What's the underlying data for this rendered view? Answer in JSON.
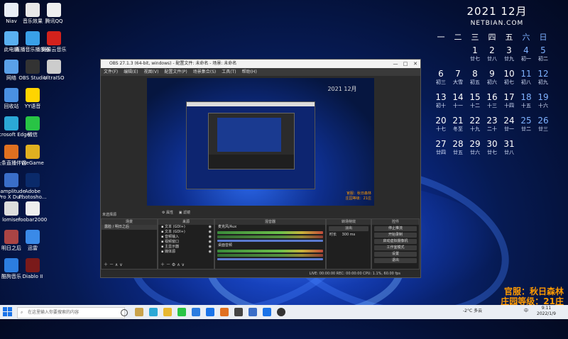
{
  "desktop": {
    "icons": [
      {
        "label": "Niav",
        "color": "#e9eef5"
      },
      {
        "label": "回收站",
        "color": "#4a90e2"
      },
      {
        "label": "网络",
        "color": "#5aa0e8"
      },
      {
        "label": "此电脑",
        "color": "#5ab0f0"
      },
      {
        "label": "音乐效果",
        "color": "#e8e8e8"
      },
      {
        "label": "Microsoft Edge",
        "color": "#2ba8d6"
      },
      {
        "label": "头条直播伴侣",
        "color": "#e07020"
      },
      {
        "label": "Samplitude Pro X Du...",
        "color": "#3a6ec8"
      },
      {
        "label": "lomiser",
        "color": "#ddd"
      },
      {
        "label": "明日之后",
        "color": "#aa4444"
      },
      {
        "label": "酷狗音乐",
        "color": "#2c7de0"
      },
      {
        "label": "腾讯QQ",
        "color": "#eee"
      },
      {
        "label": "直播音乐播放器",
        "color": "#39a0e8"
      },
      {
        "label": "OBS Studio",
        "color": "#333"
      },
      {
        "label": "YY语音",
        "color": "#ffd400"
      },
      {
        "label": "微信",
        "color": "#28c445"
      },
      {
        "label": "WeGame",
        "color": "#e0b020"
      },
      {
        "label": "Adobe Photosho...",
        "color": "#0a2a6a"
      },
      {
        "label": "foobar2000",
        "color": "#eee"
      },
      {
        "label": "迅雷",
        "color": "#3a8ae8"
      },
      {
        "label": "Diablo II",
        "color": "#7a1a1a"
      },
      {
        "label": "网易云音乐",
        "color": "#d4221c"
      },
      {
        "label": "UltraISO",
        "color": "#cccccc"
      }
    ]
  },
  "calendar": {
    "title": "2021 12月",
    "site": "NETBIAN.COM",
    "weekdays": [
      "一",
      "二",
      "三",
      "四",
      "五",
      "六",
      "日"
    ],
    "weeks": [
      [
        {
          "d": "",
          "l": ""
        },
        {
          "d": "",
          "l": ""
        },
        {
          "d": "1",
          "l": "廿七"
        },
        {
          "d": "2",
          "l": "廿八"
        },
        {
          "d": "3",
          "l": "廿九"
        },
        {
          "d": "4",
          "l": "初一"
        },
        {
          "d": "5",
          "l": "初二"
        }
      ],
      [
        {
          "d": "6",
          "l": "初三"
        },
        {
          "d": "7",
          "l": "大雪"
        },
        {
          "d": "8",
          "l": "初五"
        },
        {
          "d": "9",
          "l": "初六"
        },
        {
          "d": "10",
          "l": "初七"
        },
        {
          "d": "11",
          "l": "初八"
        },
        {
          "d": "12",
          "l": "初九"
        }
      ],
      [
        {
          "d": "13",
          "l": "初十"
        },
        {
          "d": "14",
          "l": "十一"
        },
        {
          "d": "15",
          "l": "十二"
        },
        {
          "d": "16",
          "l": "十三"
        },
        {
          "d": "17",
          "l": "十四"
        },
        {
          "d": "18",
          "l": "十五"
        },
        {
          "d": "19",
          "l": "十六"
        }
      ],
      [
        {
          "d": "20",
          "l": "十七"
        },
        {
          "d": "21",
          "l": "冬至"
        },
        {
          "d": "22",
          "l": "十九"
        },
        {
          "d": "23",
          "l": "二十"
        },
        {
          "d": "24",
          "l": "廿一"
        },
        {
          "d": "25",
          "l": "廿二"
        },
        {
          "d": "26",
          "l": "廿三"
        }
      ],
      [
        {
          "d": "27",
          "l": "廿四"
        },
        {
          "d": "28",
          "l": "廿五"
        },
        {
          "d": "29",
          "l": "廿六"
        },
        {
          "d": "30",
          "l": "廿七"
        },
        {
          "d": "31",
          "l": "廿八"
        },
        {
          "d": "",
          "l": ""
        },
        {
          "d": "",
          "l": ""
        }
      ]
    ]
  },
  "obs": {
    "title": "OBS 27.1.3 (64-bit, windows) - 配置文件: 未命名 - 场景: 未命名",
    "menu": [
      "文件(F)",
      "编辑(E)",
      "视图(V)",
      "配置文件(P)",
      "场景集合(S)",
      "工具(T)",
      "帮助(H)"
    ],
    "no_source": "未选择源",
    "props_label": "属性",
    "filters_label": "滤镜",
    "docks": {
      "scenes": {
        "title": "场景",
        "items": [
          "露脸 / 明日之后"
        ]
      },
      "sources": {
        "title": "来源",
        "items": [
          "文本 (GDI+)",
          "文本 (GDI+)",
          "音频输入",
          "视频窗口",
          "主显示器",
          "媒体源"
        ]
      },
      "mixer": {
        "title": "混音器",
        "tracks": [
          "麦克风/Aux",
          "桌面音频"
        ]
      },
      "transitions": {
        "title": "转场特效",
        "type": "淡出",
        "duration_label": "时长",
        "duration": "300 ms"
      },
      "controls": {
        "title": "控件",
        "buttons": [
          "停止推流",
          "开始录制",
          "启动虚拟摄像机",
          "工作室模式",
          "设置",
          "退出"
        ]
      }
    },
    "status": "LIVE: 00:00:00   REC: 00:00:00   CPU: 1.1%, 60.00 fps"
  },
  "overlay": {
    "line1": "官服：秋日森林",
    "line2": "庄园等级：21庄"
  },
  "taskbar": {
    "search_placeholder": "在这里输入你要搜索的内容",
    "weather": "-2°C 多云",
    "time": "9:11",
    "date": "2022/1/9",
    "ime": "中"
  }
}
